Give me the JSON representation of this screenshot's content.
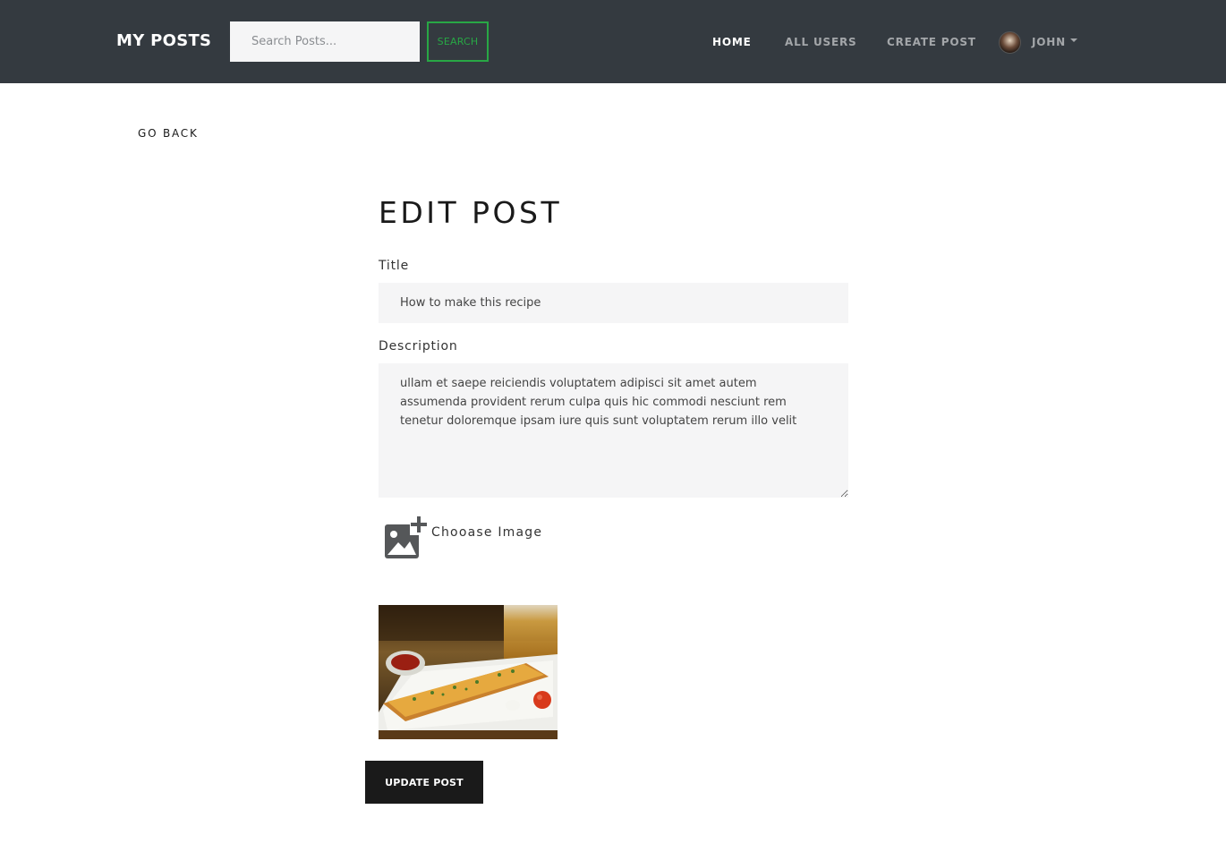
{
  "navbar": {
    "brand": "MY POSTS",
    "search_placeholder": "Search Posts...",
    "search_button": "SEARCH",
    "links": {
      "home": "HOME",
      "all_users": "ALL USERS",
      "create_post": "CREATE POST"
    },
    "user": {
      "name": "JOHN",
      "avatar_icon": "user-avatar"
    }
  },
  "go_back": "GO BACK",
  "form": {
    "heading": "EDIT POST",
    "title_label": "Title",
    "title_value": "How to make this recipe",
    "description_label": "Description",
    "description_value": "ullam et saepe reiciendis voluptatem adipisci sit amet autem assumenda provident rerum culpa quis hic commodi nesciunt rem tenetur doloremque ipsam iure quis sunt voluptatem rerum illo velit",
    "image_picker": {
      "icon": "add-photo-icon",
      "label": "Chooase Image"
    },
    "submit_label": "UPDATE POST"
  },
  "colors": {
    "navbar_bg": "#343a40",
    "search_accent": "#28a745",
    "submit_bg": "#1a1a1a",
    "field_bg": "#f5f5f6"
  }
}
